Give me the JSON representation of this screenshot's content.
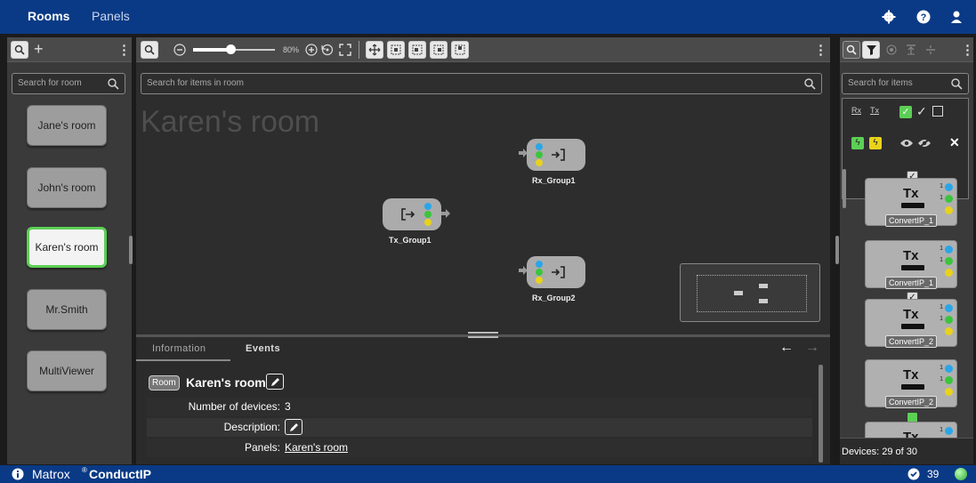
{
  "topbar": {
    "tabs": [
      "Rooms",
      "Panels"
    ]
  },
  "rooms_panel": {
    "search_placeholder": "Search for room",
    "rooms": [
      "Jane's room",
      "John's room",
      "Karen's room",
      "Mr.Smith",
      "MultiViewer"
    ],
    "active_index": 2
  },
  "canvas": {
    "zoom": "80%",
    "search_placeholder": "Search for items in room",
    "room_title": "Karen's room",
    "nodes": [
      {
        "label": "Rx_Group1",
        "kind": "rx"
      },
      {
        "label": "Tx_Group1",
        "kind": "tx"
      },
      {
        "label": "Rx_Group2",
        "kind": "rx"
      }
    ]
  },
  "info": {
    "tabs": [
      "Information",
      "Events"
    ],
    "badge": "Room",
    "title": "Karen's room",
    "rows": [
      {
        "key": "Number of devices:",
        "value": "3"
      },
      {
        "key": "Description:",
        "value": ""
      },
      {
        "key": "Panels:",
        "value": "Karen's room"
      }
    ]
  },
  "devices_panel": {
    "search_placeholder": "Search for items",
    "filter_labels": [
      "Rx",
      "Tx"
    ],
    "devices": [
      {
        "type": "Tx",
        "name": "ConvertIP_1",
        "checked": true
      },
      {
        "type": "Tx",
        "name": "ConvertIP_1",
        "checked": false
      },
      {
        "type": "Tx",
        "name": "ConvertIP_2",
        "checked": true
      },
      {
        "type": "Tx",
        "name": "ConvertIP_2",
        "checked": false
      },
      {
        "type": "Tx",
        "name": "",
        "checked": false
      }
    ],
    "count_text": "Devices: 29 of 30",
    "port_number": "1"
  },
  "statusbar": {
    "brand": "Matrox",
    "product": "ConductIP",
    "count": "39"
  },
  "colors": {
    "brand_blue": "#0a3a86",
    "active_green": "#5ccf55",
    "led_blue": "#2aa6e8",
    "led_green": "#3cc43c",
    "led_yellow": "#e8d21c"
  }
}
